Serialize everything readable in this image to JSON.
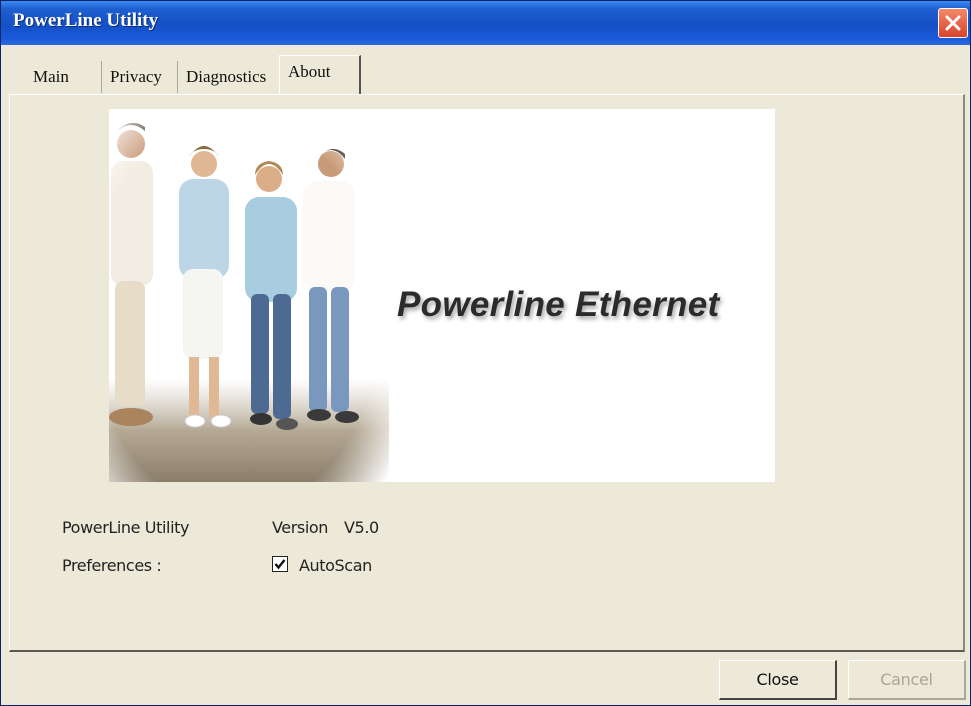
{
  "window": {
    "title": "PowerLine Utility"
  },
  "tabs": [
    {
      "label": "Main"
    },
    {
      "label": "Privacy"
    },
    {
      "label": "Diagnostics"
    },
    {
      "label": "About",
      "active": true
    }
  ],
  "about": {
    "banner_text": "Powerline Ethernet",
    "app_name_label": "PowerLine Utility",
    "version_label": "Version",
    "version_value": "V5.0",
    "preferences_label": "Preferences :",
    "autoscan_label": "AutoScan",
    "autoscan_checked": true
  },
  "buttons": {
    "close_label": "Close",
    "cancel_label": "Cancel"
  },
  "colors": {
    "titlebar": "#1450c6",
    "face": "#ece9d8",
    "close_button": "#d9432a"
  },
  "icons": {
    "window_close": "close-x-icon",
    "checkbox": "check-icon"
  }
}
